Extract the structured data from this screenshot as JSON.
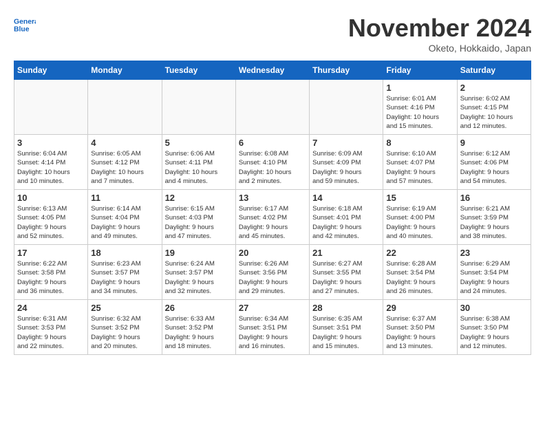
{
  "header": {
    "logo_line1": "General",
    "logo_line2": "Blue",
    "month": "November 2024",
    "location": "Oketo, Hokkaido, Japan"
  },
  "weekdays": [
    "Sunday",
    "Monday",
    "Tuesday",
    "Wednesday",
    "Thursday",
    "Friday",
    "Saturday"
  ],
  "weeks": [
    [
      {
        "day": "",
        "info": ""
      },
      {
        "day": "",
        "info": ""
      },
      {
        "day": "",
        "info": ""
      },
      {
        "day": "",
        "info": ""
      },
      {
        "day": "",
        "info": ""
      },
      {
        "day": "1",
        "info": "Sunrise: 6:01 AM\nSunset: 4:16 PM\nDaylight: 10 hours\nand 15 minutes."
      },
      {
        "day": "2",
        "info": "Sunrise: 6:02 AM\nSunset: 4:15 PM\nDaylight: 10 hours\nand 12 minutes."
      }
    ],
    [
      {
        "day": "3",
        "info": "Sunrise: 6:04 AM\nSunset: 4:14 PM\nDaylight: 10 hours\nand 10 minutes."
      },
      {
        "day": "4",
        "info": "Sunrise: 6:05 AM\nSunset: 4:12 PM\nDaylight: 10 hours\nand 7 minutes."
      },
      {
        "day": "5",
        "info": "Sunrise: 6:06 AM\nSunset: 4:11 PM\nDaylight: 10 hours\nand 4 minutes."
      },
      {
        "day": "6",
        "info": "Sunrise: 6:08 AM\nSunset: 4:10 PM\nDaylight: 10 hours\nand 2 minutes."
      },
      {
        "day": "7",
        "info": "Sunrise: 6:09 AM\nSunset: 4:09 PM\nDaylight: 9 hours\nand 59 minutes."
      },
      {
        "day": "8",
        "info": "Sunrise: 6:10 AM\nSunset: 4:07 PM\nDaylight: 9 hours\nand 57 minutes."
      },
      {
        "day": "9",
        "info": "Sunrise: 6:12 AM\nSunset: 4:06 PM\nDaylight: 9 hours\nand 54 minutes."
      }
    ],
    [
      {
        "day": "10",
        "info": "Sunrise: 6:13 AM\nSunset: 4:05 PM\nDaylight: 9 hours\nand 52 minutes."
      },
      {
        "day": "11",
        "info": "Sunrise: 6:14 AM\nSunset: 4:04 PM\nDaylight: 9 hours\nand 49 minutes."
      },
      {
        "day": "12",
        "info": "Sunrise: 6:15 AM\nSunset: 4:03 PM\nDaylight: 9 hours\nand 47 minutes."
      },
      {
        "day": "13",
        "info": "Sunrise: 6:17 AM\nSunset: 4:02 PM\nDaylight: 9 hours\nand 45 minutes."
      },
      {
        "day": "14",
        "info": "Sunrise: 6:18 AM\nSunset: 4:01 PM\nDaylight: 9 hours\nand 42 minutes."
      },
      {
        "day": "15",
        "info": "Sunrise: 6:19 AM\nSunset: 4:00 PM\nDaylight: 9 hours\nand 40 minutes."
      },
      {
        "day": "16",
        "info": "Sunrise: 6:21 AM\nSunset: 3:59 PM\nDaylight: 9 hours\nand 38 minutes."
      }
    ],
    [
      {
        "day": "17",
        "info": "Sunrise: 6:22 AM\nSunset: 3:58 PM\nDaylight: 9 hours\nand 36 minutes."
      },
      {
        "day": "18",
        "info": "Sunrise: 6:23 AM\nSunset: 3:57 PM\nDaylight: 9 hours\nand 34 minutes."
      },
      {
        "day": "19",
        "info": "Sunrise: 6:24 AM\nSunset: 3:57 PM\nDaylight: 9 hours\nand 32 minutes."
      },
      {
        "day": "20",
        "info": "Sunrise: 6:26 AM\nSunset: 3:56 PM\nDaylight: 9 hours\nand 29 minutes."
      },
      {
        "day": "21",
        "info": "Sunrise: 6:27 AM\nSunset: 3:55 PM\nDaylight: 9 hours\nand 27 minutes."
      },
      {
        "day": "22",
        "info": "Sunrise: 6:28 AM\nSunset: 3:54 PM\nDaylight: 9 hours\nand 26 minutes."
      },
      {
        "day": "23",
        "info": "Sunrise: 6:29 AM\nSunset: 3:54 PM\nDaylight: 9 hours\nand 24 minutes."
      }
    ],
    [
      {
        "day": "24",
        "info": "Sunrise: 6:31 AM\nSunset: 3:53 PM\nDaylight: 9 hours\nand 22 minutes."
      },
      {
        "day": "25",
        "info": "Sunrise: 6:32 AM\nSunset: 3:52 PM\nDaylight: 9 hours\nand 20 minutes."
      },
      {
        "day": "26",
        "info": "Sunrise: 6:33 AM\nSunset: 3:52 PM\nDaylight: 9 hours\nand 18 minutes."
      },
      {
        "day": "27",
        "info": "Sunrise: 6:34 AM\nSunset: 3:51 PM\nDaylight: 9 hours\nand 16 minutes."
      },
      {
        "day": "28",
        "info": "Sunrise: 6:35 AM\nSunset: 3:51 PM\nDaylight: 9 hours\nand 15 minutes."
      },
      {
        "day": "29",
        "info": "Sunrise: 6:37 AM\nSunset: 3:50 PM\nDaylight: 9 hours\nand 13 minutes."
      },
      {
        "day": "30",
        "info": "Sunrise: 6:38 AM\nSunset: 3:50 PM\nDaylight: 9 hours\nand 12 minutes."
      }
    ]
  ]
}
